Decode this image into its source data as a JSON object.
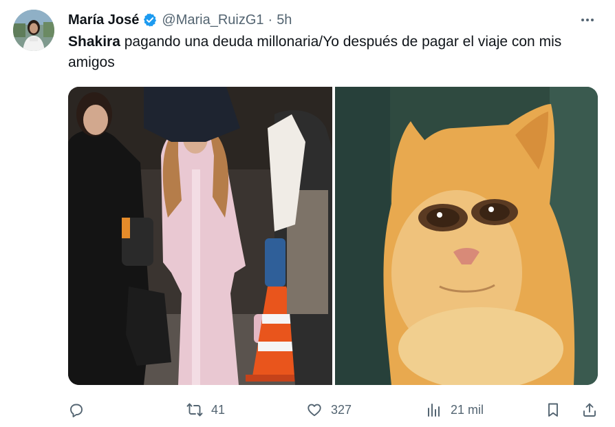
{
  "author": {
    "display_name": "María José",
    "handle": "@Maria_RuizG1",
    "separator": "·",
    "time": "5h",
    "verified": true
  },
  "tweet": {
    "bold_text": "Shakira",
    "text": " pagando una deuda millonaria/Yo después de pagar el viaje con mis amigos"
  },
  "media": {
    "count": 2
  },
  "actions": {
    "reply_icon": "reply-icon",
    "retweet_count": "41",
    "like_count": "327",
    "views_count": "21 mil"
  },
  "colors": {
    "text_primary": "#0f1419",
    "text_secondary": "#536471",
    "verified_blue": "#1d9bf0"
  }
}
